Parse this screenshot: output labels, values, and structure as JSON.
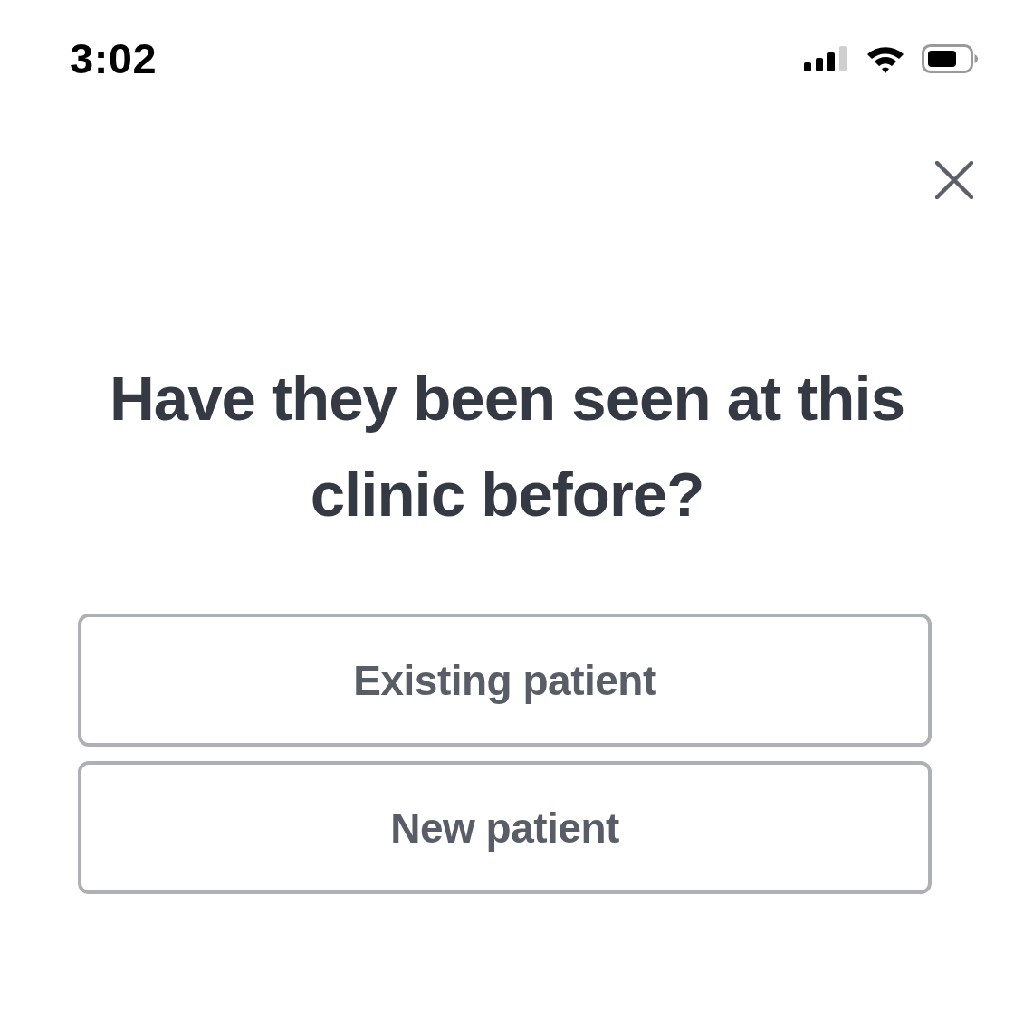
{
  "status_bar": {
    "time": "3:02"
  },
  "question": "Have they been seen at this clinic before?",
  "options": [
    {
      "label": "Existing patient"
    },
    {
      "label": "New patient"
    }
  ]
}
